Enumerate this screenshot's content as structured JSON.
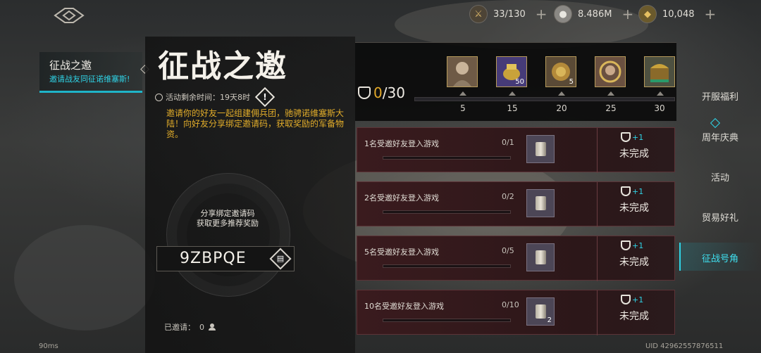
{
  "top_bar": {
    "resources": [
      {
        "icon": "stamina-icon",
        "value": "33/130"
      },
      {
        "icon": "silver-coin-icon",
        "value": "8.486M"
      },
      {
        "icon": "gold-coin-icon",
        "value": "10,048"
      }
    ]
  },
  "event_tab": {
    "name": "征战之邀",
    "subtitle": "邀请战友同征诺维塞斯!"
  },
  "main": {
    "title": "征战之邀",
    "timer": "活动剩余时间：19天8时",
    "info_glyph": "!",
    "description": "邀请你的好友一起组建佣兵团，驰骋诺维塞斯大陆！向好友分享绑定邀请码，获取奖励的军备物资。",
    "share_hint_line1": "分享绑定邀请码",
    "share_hint_line2": "获取更多推荐奖励",
    "invite_code": "9ZBPQE",
    "invited_label": "已邀请：",
    "invited_count": "0"
  },
  "progress": {
    "current": "0",
    "total": "/30",
    "milestones": [
      {
        "threshold": "5",
        "qty": ""
      },
      {
        "threshold": "15",
        "qty": "50"
      },
      {
        "threshold": "20",
        "qty": "5"
      },
      {
        "threshold": "25",
        "qty": ""
      },
      {
        "threshold": "30",
        "qty": ""
      }
    ]
  },
  "tasks": [
    {
      "title": "1名受邀好友登入游戏",
      "count": "0/1",
      "qty": "",
      "points": "+1",
      "status": "未完成"
    },
    {
      "title": "2名受邀好友登入游戏",
      "count": "0/2",
      "qty": "",
      "points": "+1",
      "status": "未完成"
    },
    {
      "title": "5名受邀好友登入游戏",
      "count": "0/5",
      "qty": "",
      "points": "+1",
      "status": "未完成"
    },
    {
      "title": "10名受邀好友登入游戏",
      "count": "0/10",
      "qty": "2",
      "points": "+1",
      "status": "未完成"
    }
  ],
  "side_tabs": [
    {
      "label": "开服福利"
    },
    {
      "label": "周年庆典"
    },
    {
      "label": "活动"
    },
    {
      "label": "贸易好礼"
    },
    {
      "label": "征战号角"
    }
  ],
  "footer": {
    "latency": "90ms",
    "uid": "UID 42962557876511"
  },
  "colors": {
    "accent": "#2fd3e6",
    "highlight": "#e2a829",
    "task_bg": "#3a1b1e"
  }
}
